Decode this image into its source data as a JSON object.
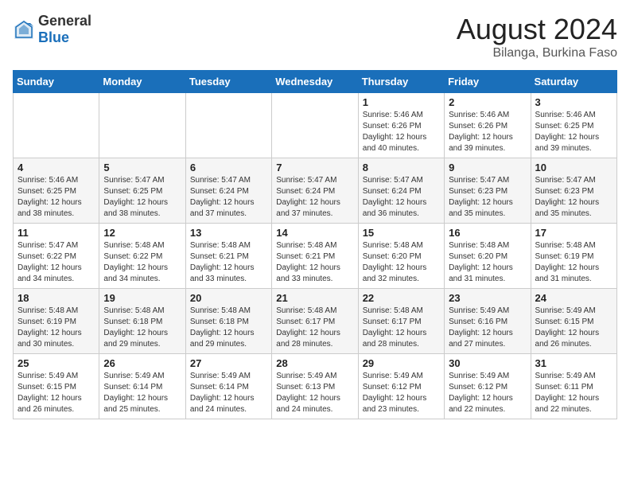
{
  "header": {
    "logo_general": "General",
    "logo_blue": "Blue",
    "title": "August 2024",
    "subtitle": "Bilanga, Burkina Faso"
  },
  "weekdays": [
    "Sunday",
    "Monday",
    "Tuesday",
    "Wednesday",
    "Thursday",
    "Friday",
    "Saturday"
  ],
  "weeks": [
    [
      {
        "day": "",
        "info": ""
      },
      {
        "day": "",
        "info": ""
      },
      {
        "day": "",
        "info": ""
      },
      {
        "day": "",
        "info": ""
      },
      {
        "day": "1",
        "info": "Sunrise: 5:46 AM\nSunset: 6:26 PM\nDaylight: 12 hours\nand 40 minutes."
      },
      {
        "day": "2",
        "info": "Sunrise: 5:46 AM\nSunset: 6:26 PM\nDaylight: 12 hours\nand 39 minutes."
      },
      {
        "day": "3",
        "info": "Sunrise: 5:46 AM\nSunset: 6:25 PM\nDaylight: 12 hours\nand 39 minutes."
      }
    ],
    [
      {
        "day": "4",
        "info": "Sunrise: 5:46 AM\nSunset: 6:25 PM\nDaylight: 12 hours\nand 38 minutes."
      },
      {
        "day": "5",
        "info": "Sunrise: 5:47 AM\nSunset: 6:25 PM\nDaylight: 12 hours\nand 38 minutes."
      },
      {
        "day": "6",
        "info": "Sunrise: 5:47 AM\nSunset: 6:24 PM\nDaylight: 12 hours\nand 37 minutes."
      },
      {
        "day": "7",
        "info": "Sunrise: 5:47 AM\nSunset: 6:24 PM\nDaylight: 12 hours\nand 37 minutes."
      },
      {
        "day": "8",
        "info": "Sunrise: 5:47 AM\nSunset: 6:24 PM\nDaylight: 12 hours\nand 36 minutes."
      },
      {
        "day": "9",
        "info": "Sunrise: 5:47 AM\nSunset: 6:23 PM\nDaylight: 12 hours\nand 35 minutes."
      },
      {
        "day": "10",
        "info": "Sunrise: 5:47 AM\nSunset: 6:23 PM\nDaylight: 12 hours\nand 35 minutes."
      }
    ],
    [
      {
        "day": "11",
        "info": "Sunrise: 5:47 AM\nSunset: 6:22 PM\nDaylight: 12 hours\nand 34 minutes."
      },
      {
        "day": "12",
        "info": "Sunrise: 5:48 AM\nSunset: 6:22 PM\nDaylight: 12 hours\nand 34 minutes."
      },
      {
        "day": "13",
        "info": "Sunrise: 5:48 AM\nSunset: 6:21 PM\nDaylight: 12 hours\nand 33 minutes."
      },
      {
        "day": "14",
        "info": "Sunrise: 5:48 AM\nSunset: 6:21 PM\nDaylight: 12 hours\nand 33 minutes."
      },
      {
        "day": "15",
        "info": "Sunrise: 5:48 AM\nSunset: 6:20 PM\nDaylight: 12 hours\nand 32 minutes."
      },
      {
        "day": "16",
        "info": "Sunrise: 5:48 AM\nSunset: 6:20 PM\nDaylight: 12 hours\nand 31 minutes."
      },
      {
        "day": "17",
        "info": "Sunrise: 5:48 AM\nSunset: 6:19 PM\nDaylight: 12 hours\nand 31 minutes."
      }
    ],
    [
      {
        "day": "18",
        "info": "Sunrise: 5:48 AM\nSunset: 6:19 PM\nDaylight: 12 hours\nand 30 minutes."
      },
      {
        "day": "19",
        "info": "Sunrise: 5:48 AM\nSunset: 6:18 PM\nDaylight: 12 hours\nand 29 minutes."
      },
      {
        "day": "20",
        "info": "Sunrise: 5:48 AM\nSunset: 6:18 PM\nDaylight: 12 hours\nand 29 minutes."
      },
      {
        "day": "21",
        "info": "Sunrise: 5:48 AM\nSunset: 6:17 PM\nDaylight: 12 hours\nand 28 minutes."
      },
      {
        "day": "22",
        "info": "Sunrise: 5:48 AM\nSunset: 6:17 PM\nDaylight: 12 hours\nand 28 minutes."
      },
      {
        "day": "23",
        "info": "Sunrise: 5:49 AM\nSunset: 6:16 PM\nDaylight: 12 hours\nand 27 minutes."
      },
      {
        "day": "24",
        "info": "Sunrise: 5:49 AM\nSunset: 6:15 PM\nDaylight: 12 hours\nand 26 minutes."
      }
    ],
    [
      {
        "day": "25",
        "info": "Sunrise: 5:49 AM\nSunset: 6:15 PM\nDaylight: 12 hours\nand 26 minutes."
      },
      {
        "day": "26",
        "info": "Sunrise: 5:49 AM\nSunset: 6:14 PM\nDaylight: 12 hours\nand 25 minutes."
      },
      {
        "day": "27",
        "info": "Sunrise: 5:49 AM\nSunset: 6:14 PM\nDaylight: 12 hours\nand 24 minutes."
      },
      {
        "day": "28",
        "info": "Sunrise: 5:49 AM\nSunset: 6:13 PM\nDaylight: 12 hours\nand 24 minutes."
      },
      {
        "day": "29",
        "info": "Sunrise: 5:49 AM\nSunset: 6:12 PM\nDaylight: 12 hours\nand 23 minutes."
      },
      {
        "day": "30",
        "info": "Sunrise: 5:49 AM\nSunset: 6:12 PM\nDaylight: 12 hours\nand 22 minutes."
      },
      {
        "day": "31",
        "info": "Sunrise: 5:49 AM\nSunset: 6:11 PM\nDaylight: 12 hours\nand 22 minutes."
      }
    ]
  ]
}
